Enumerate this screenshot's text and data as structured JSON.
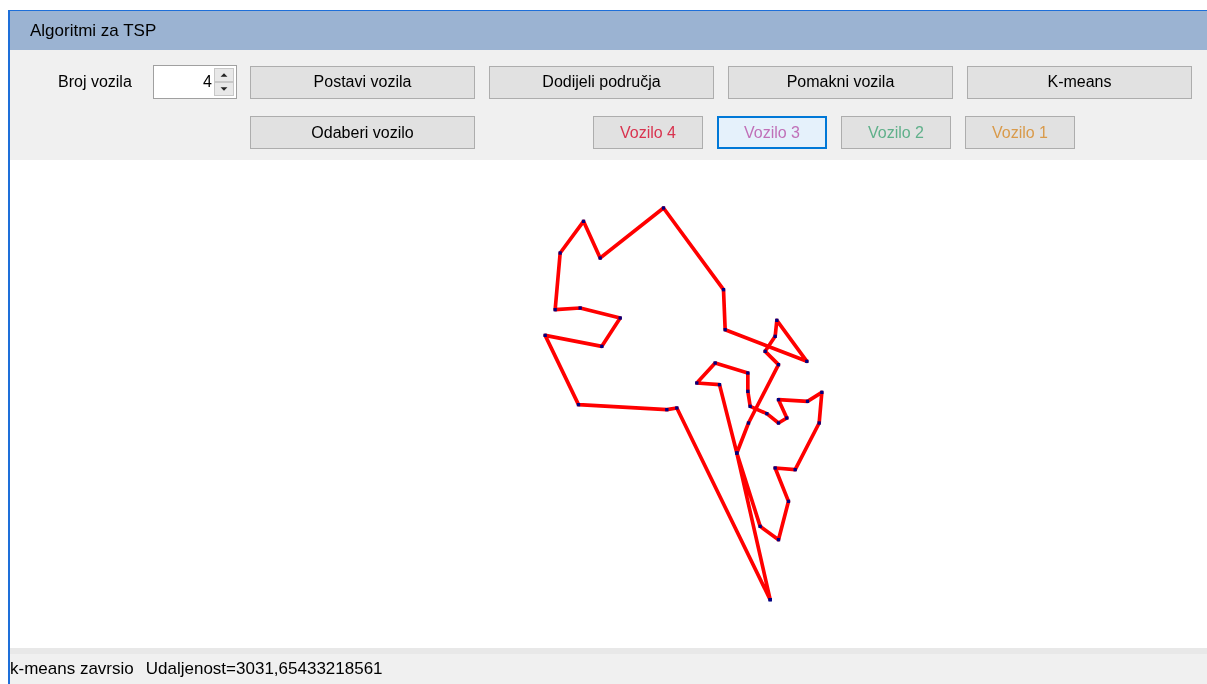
{
  "window": {
    "title": "Algoritmi za TSP"
  },
  "vehicle_count": {
    "label": "Broj vozila",
    "value": "4"
  },
  "action_buttons": [
    "Postavi vozila",
    "Dodijeli područja",
    "Pomakni vozila",
    "K-means"
  ],
  "select_button": "Odaberi vozilo",
  "vehicles": [
    {
      "label": "Vozilo 4",
      "color": "#d9334f",
      "selected": false
    },
    {
      "label": "Vozilo 3",
      "color": "#c070b8",
      "selected": true
    },
    {
      "label": "Vozilo 2",
      "color": "#5fb08a",
      "selected": false
    },
    {
      "label": "Vozilo 1",
      "color": "#d99a4a",
      "selected": false
    }
  ],
  "status_bar": [
    "k-means zavrsio",
    "Udaljenost=3031,65433218561"
  ]
}
